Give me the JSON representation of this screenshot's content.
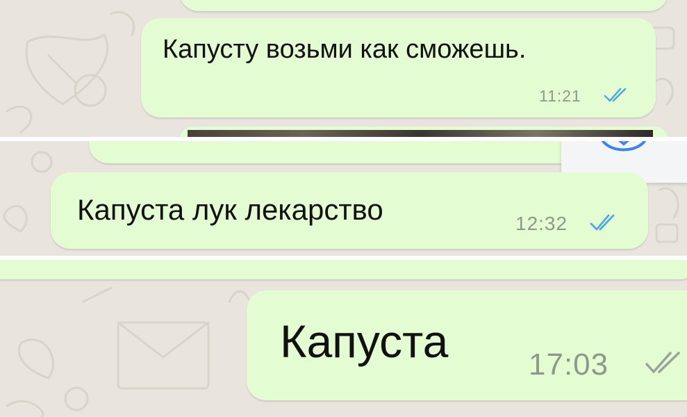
{
  "colors": {
    "wallpaper": "#e9e5de",
    "bubble": "#e3fcd1",
    "read_ticks": "#4fa7e8",
    "sent_ticks": "#9aa39a"
  },
  "messages": [
    {
      "text": "Капусту возьми как сможешь.",
      "time": "11:21",
      "status": "read",
      "status_icon": "double-check-read-icon"
    },
    {
      "text": "Капуста лук лекарство",
      "time": "12:32",
      "status": "read",
      "status_icon": "double-check-read-icon"
    },
    {
      "text": "Капуста",
      "time": "17:03",
      "status": "delivered",
      "status_icon": "double-check-delivered-icon"
    }
  ],
  "overlay": {
    "icon": "chevron-down-icon"
  }
}
